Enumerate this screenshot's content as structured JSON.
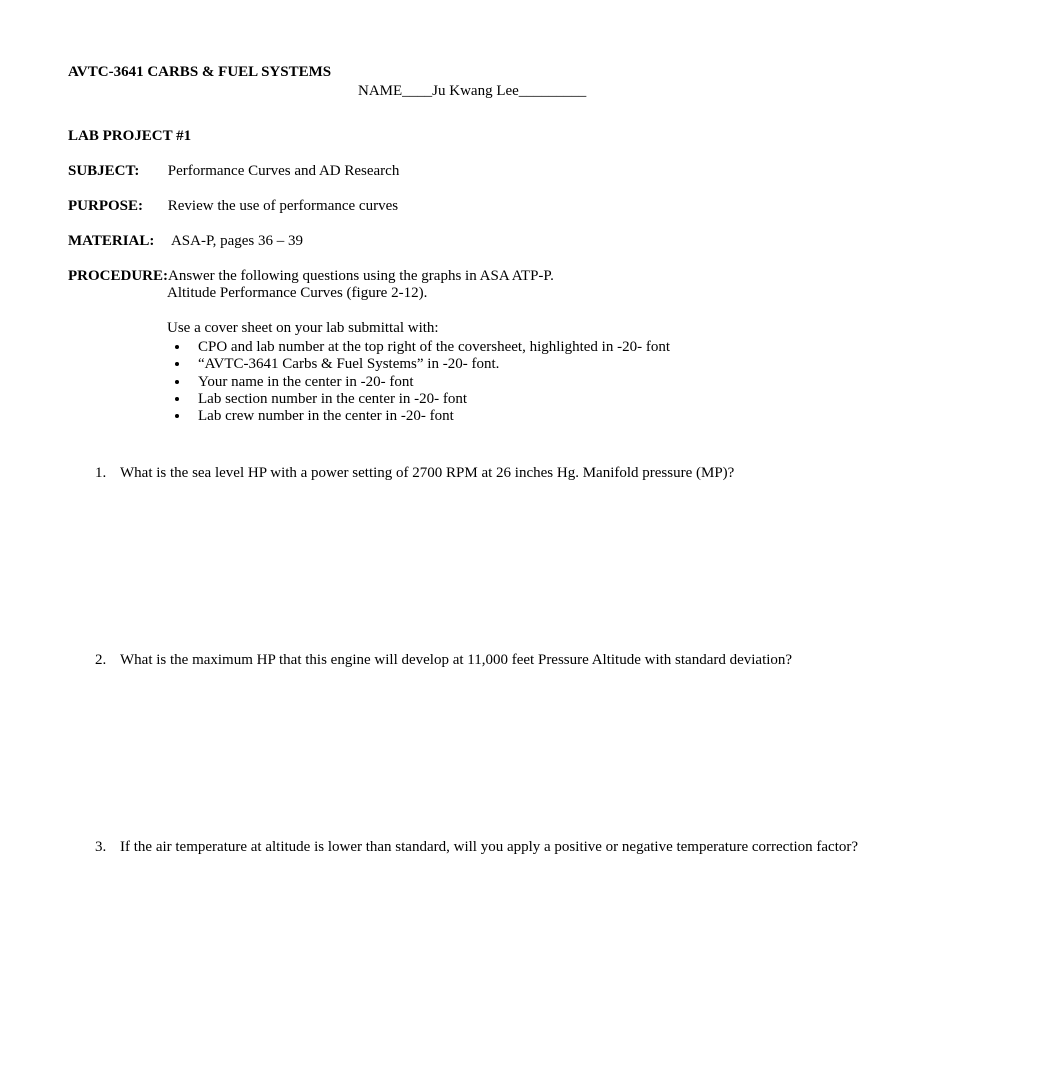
{
  "header": {
    "course_title": "AVTC-3641 CARBS & FUEL SYSTEMS",
    "name_label": "NAME____",
    "student_name": "Ju Kwang Lee_________",
    "lab_project": "LAB PROJECT #1"
  },
  "fields": {
    "subject": {
      "label": "SUBJECT:",
      "value": "Performance Curves and AD Research"
    },
    "purpose": {
      "label": "PURPOSE:",
      "value": "Review the use of performance curves"
    },
    "material": {
      "label": "MATERIAL:",
      "value": "ASA-P, pages 36 – 39"
    },
    "procedure": {
      "label": "PROCEDURE:",
      "line1": "Answer the following questions using the graphs in ASA ATP-P.",
      "line2": "Altitude Performance Curves (figure 2-12).",
      "cover_intro": "Use a cover sheet on your lab submittal with:",
      "cover_items": [
        "CPO and lab number at the top right of the coversheet, highlighted in -20- font",
        "“AVTC-3641 Carbs & Fuel Systems” in -20- font.",
        "Your name in the center in -20- font",
        "Lab section number in the center in -20- font",
        "Lab crew number in the center in -20- font"
      ]
    }
  },
  "questions": [
    "What is the sea level HP with a power setting of 2700 RPM at 26 inches Hg. Manifold pressure (MP)?",
    "What is the maximum HP that this engine will develop at 11,000 feet Pressure Altitude with standard deviation?",
    "If the air temperature at altitude is lower than standard, will you apply a positive or negative temperature correction factor?"
  ]
}
